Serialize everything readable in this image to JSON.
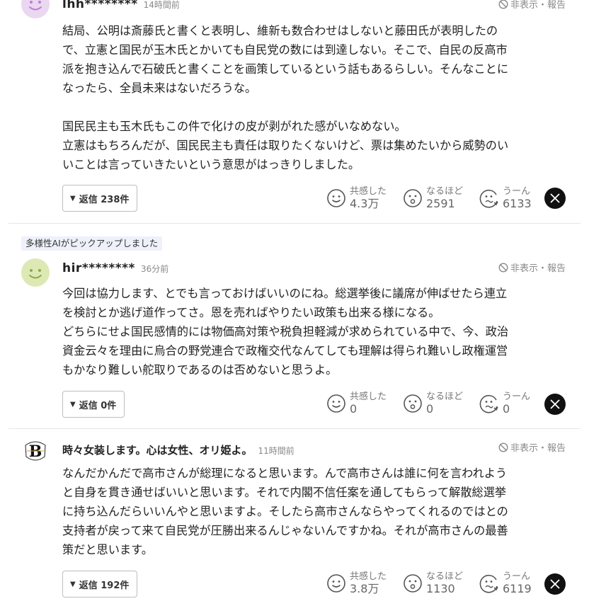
{
  "comments": [
    {
      "username": "lhh********",
      "time": "14時間前",
      "hide_report": "非表示・報告",
      "lines": [
        "結局、公明は斎藤氏と書くと表明し、維新も数合わせはしないと藤田氏が表明したの",
        "で、立憲と国民が玉木氏とかいても自民党の数には到達しない。そこで、自民の反高市",
        "派を抱き込んで石破氏と書くことを画策しているという話もあるらしい。そんなことに",
        "なったら、全員未来はないだろうな。",
        "",
        "国民民主も玉木氏もこの件で化けの皮が剥がれた感がいなめない。",
        "立憲はもちろんだが、国民民主も責任は取りたくないけど、票は集めたいから威勢のい",
        "いことは言っていきたいという意思がはっきりしました。"
      ],
      "reply_label": "返信 238件",
      "reactions": [
        {
          "label": "共感した",
          "count": "4.3万"
        },
        {
          "label": "なるほど",
          "count": "2591"
        },
        {
          "label": "うーん",
          "count": "6133"
        }
      ]
    },
    {
      "badge": "多様性AIがピックアップしました",
      "username": "hir********",
      "time": "36分前",
      "hide_report": "非表示・報告",
      "lines": [
        "今回は協力します、とでも言っておけばいいのにね。総選挙後に議席が伸ばせたら連立",
        "を検討とか逃げ道作ってさ。恩を売ればやりたい政策も出来る様になる。",
        "どちらにせよ国民感情的には物価高対策や税負担軽減が求められている中で、今、政治",
        "資金云々を理由に烏合の野党連合で政権交代なんてしても理解は得られ難いし政権運営",
        "もかなり難しい舵取りであるのは否めないと思うよ。"
      ],
      "reply_label": "返信 0件",
      "reactions": [
        {
          "label": "共感した",
          "count": "0"
        },
        {
          "label": "なるほど",
          "count": "0"
        },
        {
          "label": "うーん",
          "count": "0"
        }
      ]
    },
    {
      "username": "時々女装します。心は女性、オリ姫よ。",
      "time": "11時間前",
      "hide_report": "非表示・報告",
      "lines": [
        "なんだかんだで高市さんが総理になると思います。んで高市さんは誰に何を言われよう",
        "と自身を貫き通せばいいと思います。それで内閣不信任案を通してもらって解散総選挙",
        "に持ち込んだらいいんやと思いますよ。そしたら高市さんならやってくれるのではとの",
        "支持者が戻って来て自民党が圧勝出来るんじゃないんですかね。それが高市さんの最善",
        "策だと思います。"
      ],
      "reply_label": "返信 192件",
      "reactions": [
        {
          "label": "共感した",
          "count": "3.8万"
        },
        {
          "label": "なるほど",
          "count": "1130"
        },
        {
          "label": "うーん",
          "count": "6119"
        }
      ]
    }
  ],
  "icons": {
    "empathy": "smile-face-icon",
    "insight": "surprised-face-icon",
    "hmm": "puzzled-face-icon",
    "share": "x-logo-icon",
    "hide": "prohibited-icon"
  },
  "colors": {
    "avatar1": "#ead7f0",
    "avatar2": "#dde9b4",
    "badge_bg": "#eef1fa",
    "share_bg": "#111111"
  }
}
